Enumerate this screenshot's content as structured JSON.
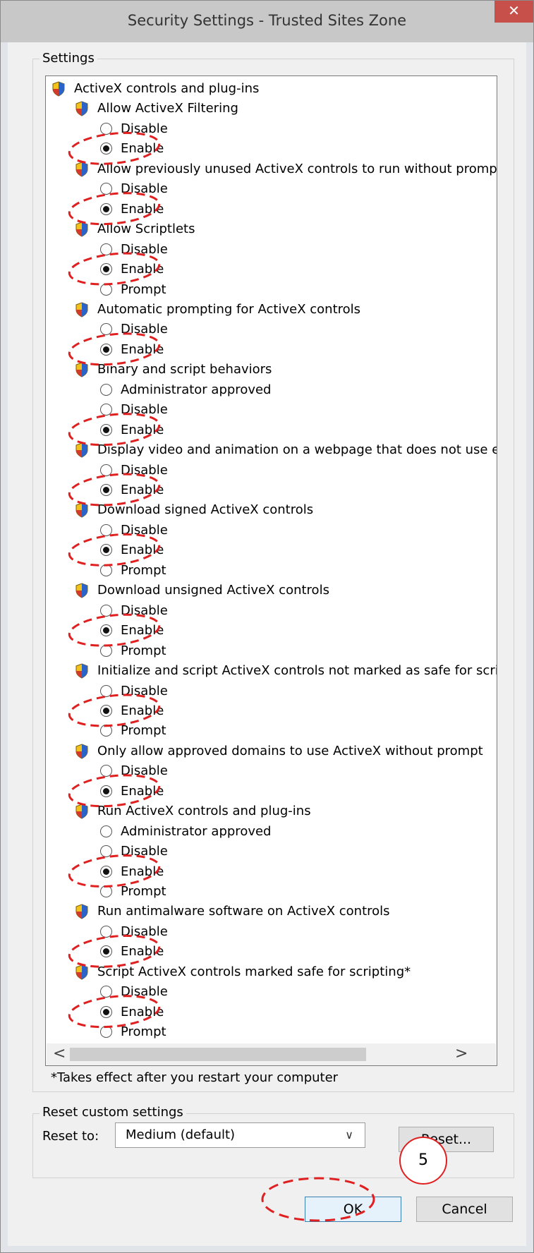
{
  "window": {
    "title": "Security Settings - Trusted Sites Zone",
    "close_glyph": "✕"
  },
  "settings_group": {
    "legend": "Settings",
    "footnote": "*Takes effect after you restart your computer"
  },
  "tree": [
    {
      "kind": "category",
      "label": "ActiveX controls and plug-ins"
    },
    {
      "kind": "setting",
      "label": "Allow ActiveX Filtering"
    },
    {
      "kind": "option",
      "label": "Disable",
      "selected": false
    },
    {
      "kind": "option",
      "label": "Enable",
      "selected": true,
      "circled": true
    },
    {
      "kind": "setting",
      "label": "Allow previously unused ActiveX controls to run without prompt"
    },
    {
      "kind": "option",
      "label": "Disable",
      "selected": false
    },
    {
      "kind": "option",
      "label": "Enable",
      "selected": true,
      "circled": true
    },
    {
      "kind": "setting",
      "label": "Allow Scriptlets"
    },
    {
      "kind": "option",
      "label": "Disable",
      "selected": false
    },
    {
      "kind": "option",
      "label": "Enable",
      "selected": true,
      "circled": true
    },
    {
      "kind": "option",
      "label": "Prompt",
      "selected": false
    },
    {
      "kind": "setting",
      "label": "Automatic prompting for ActiveX controls"
    },
    {
      "kind": "option",
      "label": "Disable",
      "selected": false
    },
    {
      "kind": "option",
      "label": "Enable",
      "selected": true,
      "circled": true
    },
    {
      "kind": "setting",
      "label": "Binary and script behaviors"
    },
    {
      "kind": "option",
      "label": "Administrator approved",
      "selected": false
    },
    {
      "kind": "option",
      "label": "Disable",
      "selected": false
    },
    {
      "kind": "option",
      "label": "Enable",
      "selected": true,
      "circled": true
    },
    {
      "kind": "setting",
      "label": "Display video and animation on a webpage that does not use ext"
    },
    {
      "kind": "option",
      "label": "Disable",
      "selected": false
    },
    {
      "kind": "option",
      "label": "Enable",
      "selected": true,
      "circled": true
    },
    {
      "kind": "setting",
      "label": "Download signed ActiveX controls"
    },
    {
      "kind": "option",
      "label": "Disable",
      "selected": false
    },
    {
      "kind": "option",
      "label": "Enable",
      "selected": true,
      "circled": true
    },
    {
      "kind": "option",
      "label": "Prompt",
      "selected": false
    },
    {
      "kind": "setting",
      "label": "Download unsigned ActiveX controls"
    },
    {
      "kind": "option",
      "label": "Disable",
      "selected": false
    },
    {
      "kind": "option",
      "label": "Enable",
      "selected": true,
      "circled": true
    },
    {
      "kind": "option",
      "label": "Prompt",
      "selected": false
    },
    {
      "kind": "setting",
      "label": "Initialize and script ActiveX controls not marked as safe for script"
    },
    {
      "kind": "option",
      "label": "Disable",
      "selected": false
    },
    {
      "kind": "option",
      "label": "Enable",
      "selected": true,
      "circled": true
    },
    {
      "kind": "option",
      "label": "Prompt",
      "selected": false
    },
    {
      "kind": "setting",
      "label": "Only allow approved domains to use ActiveX without prompt"
    },
    {
      "kind": "option",
      "label": "Disable",
      "selected": false
    },
    {
      "kind": "option",
      "label": "Enable",
      "selected": true,
      "circled": true
    },
    {
      "kind": "setting",
      "label": "Run ActiveX controls and plug-ins"
    },
    {
      "kind": "option",
      "label": "Administrator approved",
      "selected": false
    },
    {
      "kind": "option",
      "label": "Disable",
      "selected": false
    },
    {
      "kind": "option",
      "label": "Enable",
      "selected": true,
      "circled": true
    },
    {
      "kind": "option",
      "label": "Prompt",
      "selected": false
    },
    {
      "kind": "setting",
      "label": "Run antimalware software on ActiveX controls"
    },
    {
      "kind": "option",
      "label": "Disable",
      "selected": false
    },
    {
      "kind": "option",
      "label": "Enable",
      "selected": true,
      "circled": true
    },
    {
      "kind": "setting",
      "label": "Script ActiveX controls marked safe for scripting*"
    },
    {
      "kind": "option",
      "label": "Disable",
      "selected": false
    },
    {
      "kind": "option",
      "label": "Enable",
      "selected": true,
      "circled": true
    },
    {
      "kind": "option",
      "label": "Prompt",
      "selected": false
    }
  ],
  "scrollbar": {
    "left_arrow": "<",
    "right_arrow": ">"
  },
  "reset_group": {
    "legend": "Reset custom settings",
    "reset_to_label": "Reset to:",
    "selected_level": "Medium (default)",
    "reset_button": "Reset..."
  },
  "footer": {
    "ok_label": "OK",
    "cancel_label": "Cancel"
  },
  "annotation": {
    "step_number": "5",
    "color": "#e02020"
  }
}
